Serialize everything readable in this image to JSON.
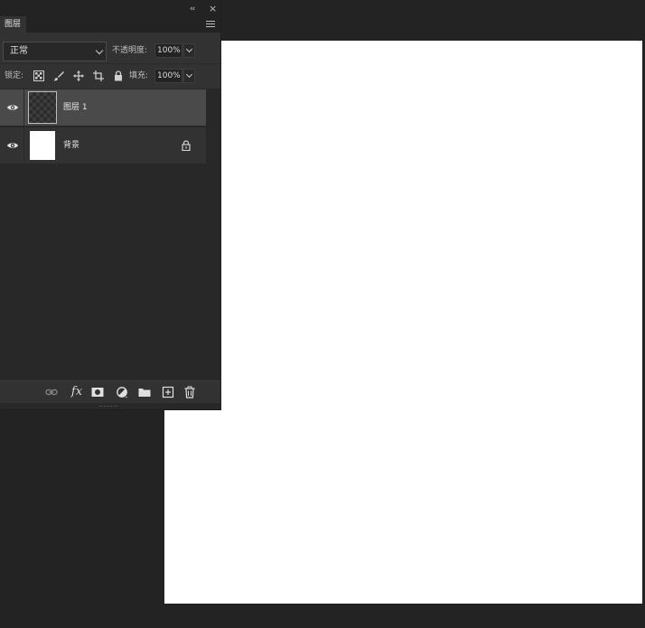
{
  "panel": {
    "tab_label": "图层",
    "collapse_glyph": "‹‹",
    "close_glyph": "×"
  },
  "blend": {
    "mode": "正常"
  },
  "opacity": {
    "label": "不透明度:",
    "value": "100%"
  },
  "lock": {
    "label": "锁定:"
  },
  "fill": {
    "label": "填充:",
    "value": "100%"
  },
  "layers": [
    {
      "name": "图层 1",
      "selected": true,
      "thumbnail": "transparent-checker"
    },
    {
      "name": "背景",
      "selected": false,
      "thumbnail": "white",
      "locked": true
    }
  ],
  "bottom_bar": {
    "icons": [
      "link-icon",
      "fx-icon",
      "mask-icon",
      "adjustment-icon",
      "folder-icon",
      "new-layer-icon",
      "trash-icon"
    ],
    "fx_label": "fx"
  },
  "colors": {
    "app_bg": "#232323",
    "panel_bg": "#282828",
    "selected_layer": "#4a4a4a",
    "canvas": "#ffffff"
  }
}
